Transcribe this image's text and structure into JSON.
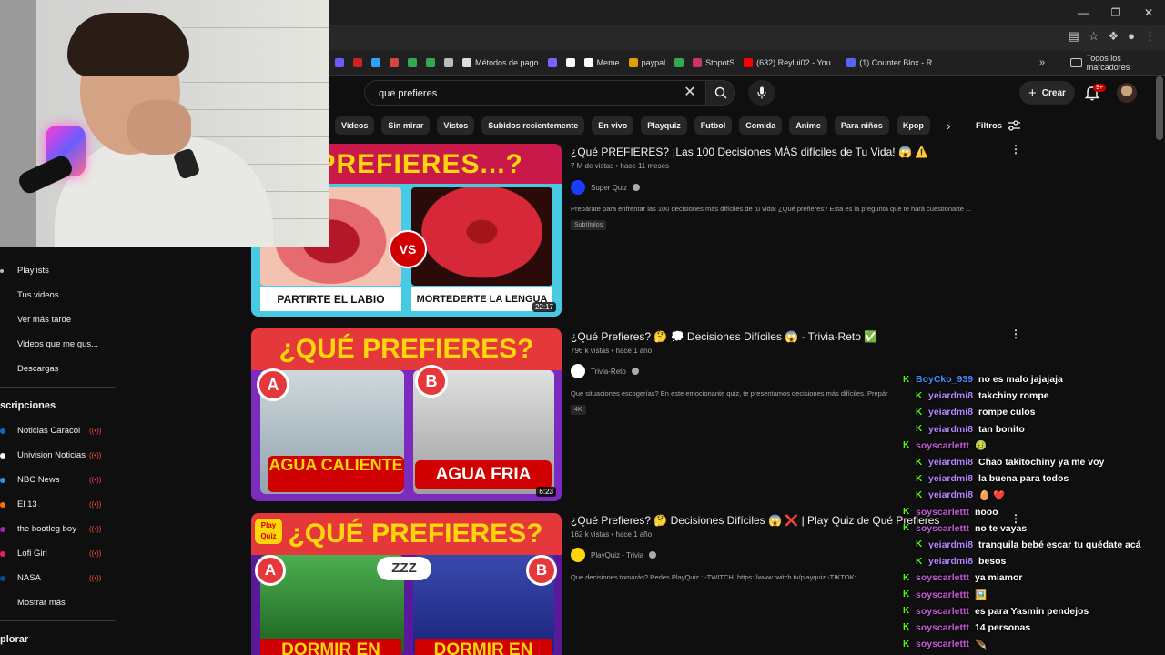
{
  "search": {
    "value": "que prefieres"
  },
  "bookmarks": [
    {
      "label": "",
      "color": "#6b5cff"
    },
    {
      "label": "",
      "color": "#cc2222"
    },
    {
      "label": "",
      "color": "#2aa3ff"
    },
    {
      "label": "",
      "color": "#d64545"
    },
    {
      "label": "",
      "color": "#34a853"
    },
    {
      "label": "",
      "color": "#34a853"
    },
    {
      "label": "",
      "color": "#bbbbbb"
    },
    {
      "label": "Métodos de pago",
      "color": "#dddddd"
    },
    {
      "label": "",
      "color": "#7b61ff"
    },
    {
      "label": "",
      "color": "#ffffff"
    },
    {
      "label": "Meme",
      "color": "#ffffff"
    },
    {
      "label": "paypal",
      "color": "#e0a000"
    },
    {
      "label": "",
      "color": "#34a853"
    },
    {
      "label": "StopotS",
      "color": "#cc3366"
    },
    {
      "label": "(632) Reylui02 - You...",
      "color": "#ff0000"
    },
    {
      "label": "(1) Counter Blox - R...",
      "color": "#5865f2"
    }
  ],
  "bookmarks_all": "Todos los marcadores",
  "header": {
    "create_label": "Crear",
    "notif_count": "9+"
  },
  "chips": [
    "Videos",
    "Sin mirar",
    "Vistos",
    "Subidos recientemente",
    "En vivo",
    "Playquiz",
    "Futbol",
    "Comida",
    "Anime",
    "Para niños",
    "Kpop"
  ],
  "filters_label": "Filtros",
  "sidebar": {
    "items": [
      "Playlists",
      "Tus videos",
      "Ver más tarde",
      "Videos que me gus...",
      "Descargas"
    ],
    "subs_heading": "scripciones",
    "subs": [
      {
        "label": "Noticias Caracol",
        "color": "#1565c0",
        "live": true
      },
      {
        "label": "Univision Noticias",
        "color": "#ffffff",
        "live": true
      },
      {
        "label": "NBC News",
        "color": "#2196f3",
        "live": true
      },
      {
        "label": "El 13",
        "color": "#ff6d00",
        "live": true
      },
      {
        "label": "the bootleg boy",
        "color": "#9c27b0",
        "live": true
      },
      {
        "label": "Lofi Girl",
        "color": "#e91e63",
        "live": true
      },
      {
        "label": "NASA",
        "color": "#0d47a1",
        "live": true
      },
      {
        "label": "Mostrar más",
        "color": "",
        "live": false
      }
    ],
    "explore_heading": "plorar"
  },
  "videos": [
    {
      "thumb_title": "É PREFIERES...?",
      "left_label": "PARTIRTE EL LABIO",
      "right_label": "MORTEDERTE LA LENGUA",
      "vs": "VS",
      "duration": "22:17",
      "title": "¿Qué PREFIERES? ¡Las 100 Decisiones MÁS difíciles de Tu Vida! 😱 ⚠️",
      "meta": "7 M de vistas • hace 11 meses",
      "channel": "Super Quiz",
      "description": "Prepárate para enfrentar las 100 decisiones más difíciles de tu vida! ¿Qué prefieres? Esta es la pregunta que te hará cuestionarte ...",
      "badge": "Subtítulos"
    },
    {
      "thumb_title": "¿QUÉ PREFIERES?",
      "opt_a": "A",
      "opt_b": "B",
      "left_label": "AGUA CALIENTE",
      "right_label": "AGUA FRIA",
      "duration": "6:23",
      "title": "¿Qué Prefieres? 🤔 💭 Decisiones Difíciles 😱 - Trivia-Reto ✅",
      "meta": "796 k vistas • hace 1 año",
      "channel": "Trivia-Reto",
      "description": "Qué situaciones escogerías? En este emocionante quiz, te presentamos decisiones más difíciles. Prepár",
      "badge": "4K"
    },
    {
      "thumb_title": "¿QUÉ PREFIERES?",
      "opt_a": "A",
      "opt_b": "B",
      "zzz": "ZZZ",
      "brand": "Play Quiz",
      "left_label": "DORMIR EN",
      "right_label": "DORMIR EN",
      "title": "¿Qué Prefieres? 🤔 Decisiones Difíciles 😱 ❌ | Play Quiz de Qué Prefieres",
      "meta": "162 k vistas • hace 1 año",
      "channel": "PlayQuiz - Trivia",
      "description": "Qué decisiones tomarás? Redes PlayQuiz : -TWITCH: https://www.twitch.tv/playquiz -TIKTOK: ..."
    }
  ],
  "chat": [
    {
      "user": "BoyCko_939",
      "color": "#4a8cff",
      "msg": "no es malo jajajaja"
    },
    {
      "user": "yeiardmi8",
      "color": "#b388ff",
      "msg": "takchiny rompe"
    },
    {
      "user": "yeiardmi8",
      "color": "#b388ff",
      "msg": "rompe culos"
    },
    {
      "user": "yeiardmi8",
      "color": "#b388ff",
      "msg": "tan bonito"
    },
    {
      "user": "soyscarlettt",
      "color": "#c45bd6",
      "msg": "🤢"
    },
    {
      "user": "yeiardmi8",
      "color": "#b388ff",
      "msg": "Chao takitochiny ya me voy"
    },
    {
      "user": "yeiardmi8",
      "color": "#b388ff",
      "msg": "la buena para todos"
    },
    {
      "user": "yeiardmi8",
      "color": "#b388ff",
      "msg": "🥚 ❤️"
    },
    {
      "user": "soyscarlettt",
      "color": "#c45bd6",
      "msg": "nooo"
    },
    {
      "user": "soyscarlettt",
      "color": "#c45bd6",
      "msg": "no te vayas"
    },
    {
      "user": "yeiardmi8",
      "color": "#b388ff",
      "msg": "tranquila bebé escar tu quédate acá"
    },
    {
      "user": "yeiardmi8",
      "color": "#b388ff",
      "msg": "besos"
    },
    {
      "user": "soyscarlettt",
      "color": "#c45bd6",
      "msg": "ya miamor"
    },
    {
      "user": "soyscarlettt",
      "color": "#c45bd6",
      "msg": "🖼️"
    },
    {
      "user": "soyscarlettt",
      "color": "#c45bd6",
      "msg": "es para Yasmin pendejos"
    },
    {
      "user": "soyscarlettt",
      "color": "#c45bd6",
      "msg": "14 personas"
    },
    {
      "user": "soyscarlettt",
      "color": "#c45bd6",
      "msg": "🪶"
    }
  ]
}
